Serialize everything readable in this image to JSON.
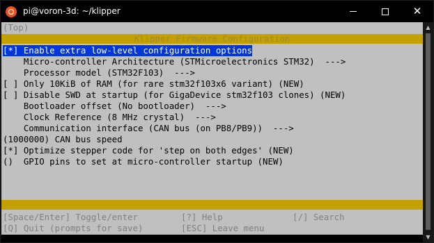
{
  "window": {
    "title": "pi@voron-3d: ~/klipper"
  },
  "screen": {
    "top_marker": "(Top)",
    "header": "Klipper Firmware Configuration",
    "items": [
      {
        "text": "[*] Enable extra low-level configuration options",
        "selected": true
      },
      {
        "text": "    Micro-controller Architecture (STMicroelectronics STM32)  --->"
      },
      {
        "text": "    Processor model (STM32F103)  --->"
      },
      {
        "text": "[ ] Only 10KiB of RAM (for rare stm32f103x6 variant) (NEW)"
      },
      {
        "text": "[ ] Disable SWD at startup (for GigaDevice stm32f103 clones) (NEW)"
      },
      {
        "text": "    Bootloader offset (No bootloader)  --->"
      },
      {
        "text": "    Clock Reference (8 MHz crystal)  --->"
      },
      {
        "text": "    Communication interface (CAN bus (on PB8/PB9))  --->"
      },
      {
        "text": "(1000000) CAN bus speed"
      },
      {
        "text": "[*] Optimize stepper code for 'step on both edges' (NEW)"
      },
      {
        "text": "()  GPIO pins to set at micro-controller startup (NEW)"
      }
    ],
    "footer": {
      "toggle": "[Space/Enter] Toggle/enter",
      "help": "[?] Help",
      "search": "[/] Search",
      "quit": "[Q] Quit (prompts for save)",
      "leave": "[ESC] Leave menu"
    }
  },
  "colors": {
    "terminal_bg": "#c0c0c0",
    "band": "#c4a000",
    "selection": "#0037da",
    "dim_text": "#808080"
  }
}
